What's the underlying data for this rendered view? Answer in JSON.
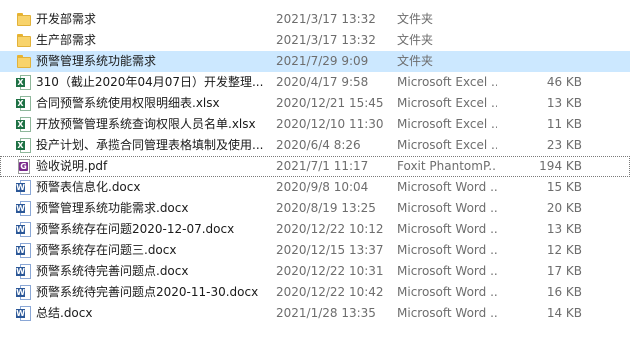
{
  "files": [
    {
      "name": "开发部需求",
      "date": "2021/3/17 13:32",
      "type": "文件夹",
      "size": "",
      "icon": "folder-icon"
    },
    {
      "name": "生产部需求",
      "date": "2021/3/17 13:32",
      "type": "文件夹",
      "size": "",
      "icon": "folder-icon"
    },
    {
      "name": "预警管理系统功能需求",
      "date": "2021/7/29 9:09",
      "type": "文件夹",
      "size": "",
      "icon": "folder-icon"
    },
    {
      "name": "310（截止2020年04月07日）开发整理...",
      "date": "2020/4/17 9:58",
      "type": "Microsoft Excel ...",
      "size": "46 KB",
      "icon": "excel-icon"
    },
    {
      "name": "合同预警系统使用权限明细表.xlsx",
      "date": "2020/12/21 15:45",
      "type": "Microsoft Excel ...",
      "size": "13 KB",
      "icon": "excel-icon"
    },
    {
      "name": "开放预警管理系统查询权限人员名单.xlsx",
      "date": "2020/12/10 11:30",
      "type": "Microsoft Excel ...",
      "size": "11 KB",
      "icon": "excel-icon"
    },
    {
      "name": "投产计划、承揽合同管理表格填制及使用...",
      "date": "2020/6/4 8:26",
      "type": "Microsoft Excel ...",
      "size": "23 KB",
      "icon": "excel-icon"
    },
    {
      "name": "验收说明.pdf",
      "date": "2021/7/1 11:17",
      "type": "Foxit PhantomP...",
      "size": "194 KB",
      "icon": "pdf-icon"
    },
    {
      "name": "预警表信息化.docx",
      "date": "2020/9/8 10:04",
      "type": "Microsoft Word ...",
      "size": "15 KB",
      "icon": "word-icon"
    },
    {
      "name": "预警管理系统功能需求.docx",
      "date": "2020/8/19 13:25",
      "type": "Microsoft Word ...",
      "size": "20 KB",
      "icon": "word-icon"
    },
    {
      "name": "预警系统存在问题2020-12-07.docx",
      "date": "2020/12/22 10:12",
      "type": "Microsoft Word ...",
      "size": "13 KB",
      "icon": "word-icon"
    },
    {
      "name": "预警系统存在问题三.docx",
      "date": "2020/12/15 13:37",
      "type": "Microsoft Word ...",
      "size": "12 KB",
      "icon": "word-icon"
    },
    {
      "name": "预警系统待完善问题点.docx",
      "date": "2020/12/22 10:31",
      "type": "Microsoft Word ...",
      "size": "17 KB",
      "icon": "word-icon"
    },
    {
      "name": "预警系统待完善问题点2020-11-30.docx",
      "date": "2020/12/22 10:42",
      "type": "Microsoft Word ...",
      "size": "16 KB",
      "icon": "word-icon"
    },
    {
      "name": "总结.docx",
      "date": "2021/1/28 13:35",
      "type": "Microsoft Word ...",
      "size": "14 KB",
      "icon": "word-icon"
    }
  ],
  "selected_index": 2,
  "focused_index": 7
}
